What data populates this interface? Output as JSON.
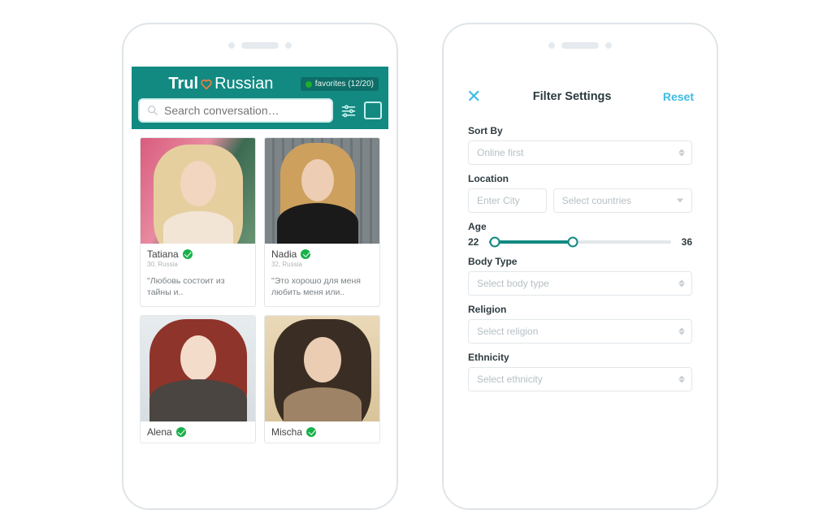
{
  "brand": {
    "prefix": "Trul",
    "suffix": "Russian"
  },
  "favorites_label": "favorites (12/20)",
  "search": {
    "placeholder": "Search conversation…"
  },
  "profiles": [
    {
      "name": "Tatiana",
      "meta": "30, Russia",
      "quote": "\"Любовь состоит из тайны и.."
    },
    {
      "name": "Nadia",
      "meta": "32, Russia",
      "quote": "\"Это хорошо для меня любить меня или.."
    },
    {
      "name": "Alena",
      "meta": "",
      "quote": ""
    },
    {
      "name": "Mischa",
      "meta": "",
      "quote": ""
    }
  ],
  "filter": {
    "title": "Filter Settings",
    "reset": "Reset",
    "sort_by_label": "Sort By",
    "sort_by_value": "Online first",
    "location_label": "Location",
    "city_placeholder": "Enter City",
    "countries_placeholder": "Select countries",
    "age_label": "Age",
    "age_min": "22",
    "age_max": "36",
    "body_label": "Body Type",
    "body_placeholder": "Select body type",
    "religion_label": "Religion",
    "religion_placeholder": "Select religion",
    "ethnicity_label": "Ethnicity",
    "ethnicity_placeholder": "Select ethnicity"
  }
}
